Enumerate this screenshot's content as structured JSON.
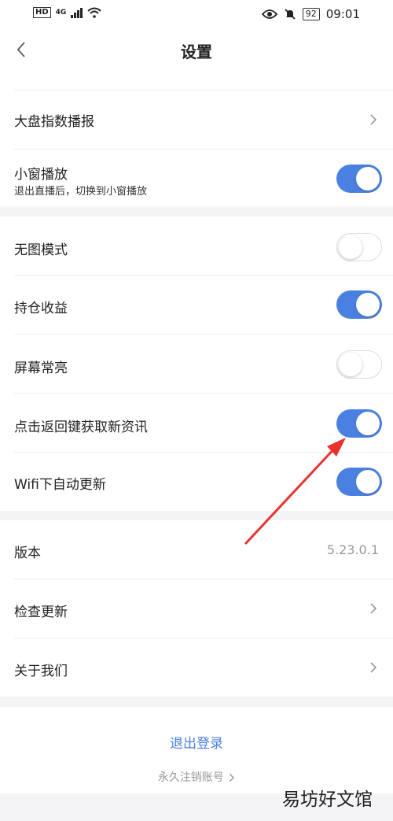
{
  "status_bar": {
    "hd": "HD",
    "network": "4G",
    "battery": "92",
    "time": "09:01"
  },
  "header": {
    "title": "设置"
  },
  "section1": {
    "market_broadcast": "大盘指数播报",
    "mini_window": {
      "label": "小窗播放",
      "subtitle": "退出直播后，切换到小窗播放",
      "on": true
    }
  },
  "section2": {
    "items": [
      {
        "label": "无图模式",
        "on": false
      },
      {
        "label": "持仓收益",
        "on": true
      },
      {
        "label": "屏幕常亮",
        "on": false
      },
      {
        "label": "点击返回键获取新资讯",
        "on": true
      },
      {
        "label": "Wifi下自动更新",
        "on": true
      }
    ]
  },
  "section3": {
    "version_label": "版本",
    "version_value": "5.23.0.1",
    "check_update": "检查更新",
    "about_us": "关于我们"
  },
  "footer": {
    "logout": "退出登录",
    "deregister": "永久注销账号"
  },
  "watermark": "易坊好文馆",
  "colors": {
    "accent": "#4a80e0",
    "annotation": "#e8322f"
  }
}
